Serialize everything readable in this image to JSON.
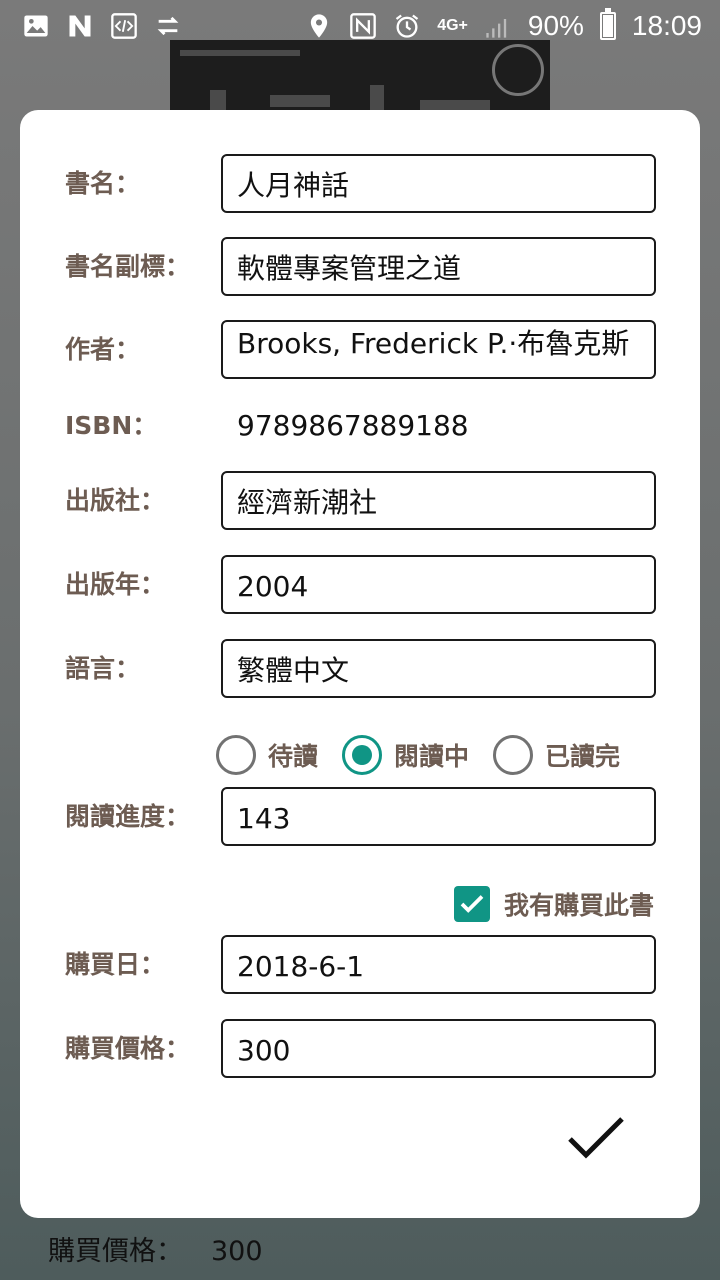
{
  "status_bar": {
    "battery_text": "90%",
    "time": "18:09",
    "network": "4G+",
    "battery_level": 0.9,
    "icons": [
      "image-icon",
      "n-icon",
      "code-icon",
      "sync-icon",
      "location-icon",
      "nfc-icon",
      "alarm-icon",
      "signal-icon",
      "battery-icon"
    ]
  },
  "form": {
    "title_label": "書名：",
    "title_value": "人月神話",
    "subtitle_label": "書名副標：",
    "subtitle_value": "軟體專案管理之道",
    "author_label": "作者：",
    "author_value": "Brooks, Frederick P.·布魯克斯",
    "isbn_label": "ISBN：",
    "isbn_value": "9789867889188",
    "publisher_label": "出版社：",
    "publisher_value": "經濟新潮社",
    "year_label": "出版年：",
    "year_value": "2004",
    "language_label": "語言：",
    "language_value": "繁體中文",
    "reading_status": {
      "options": [
        "待讀",
        "閱讀中",
        "已讀完"
      ],
      "selected": "閱讀中"
    },
    "progress_label": "閱讀進度：",
    "progress_value": "143",
    "purchased_label": "我有購買此書",
    "purchased_checked": true,
    "purchase_date_label": "購買日：",
    "purchase_date_value": "2018-6-1",
    "price_label": "購買價格：",
    "price_value": "300"
  },
  "background": {
    "peek_label": "購買價格：",
    "peek_value": "300"
  },
  "colors": {
    "accent": "#109585",
    "label": "#6d5c52",
    "field_border": "#1a1a1a"
  }
}
